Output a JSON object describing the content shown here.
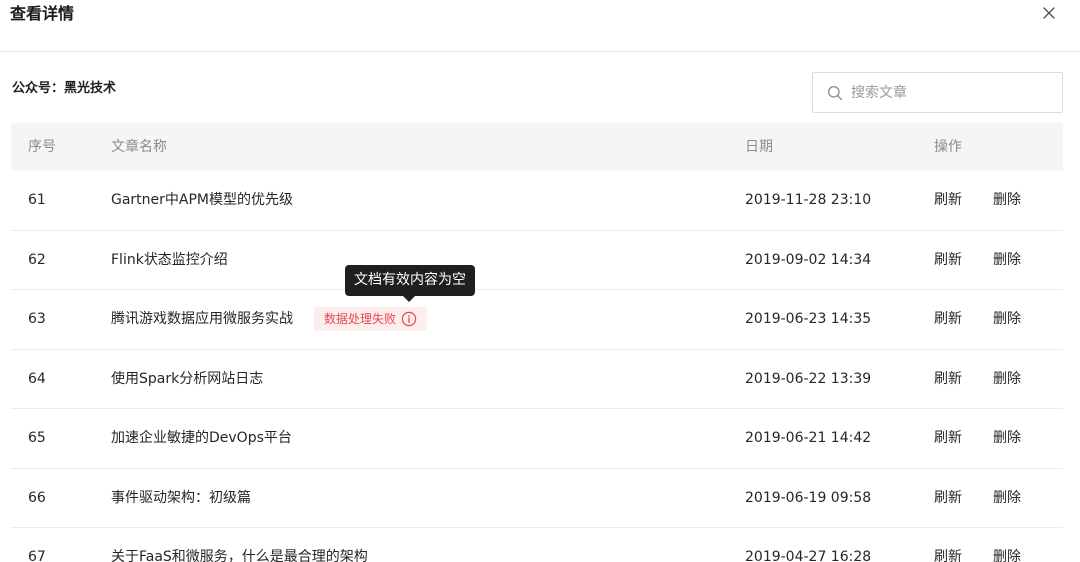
{
  "dialog": {
    "title": "查看详情"
  },
  "account": {
    "label": "公众号：黑光技术"
  },
  "search": {
    "placeholder": "搜索文章"
  },
  "table": {
    "headers": {
      "num": "序号",
      "name": "文章名称",
      "date": "日期",
      "ops": "操作"
    },
    "rows": [
      {
        "num": "61",
        "name": "Gartner中APM模型的优先级",
        "date": "2019-11-28 23:10",
        "refresh": "刷新",
        "delete": "删除"
      },
      {
        "num": "62",
        "name": "Flink状态监控介绍",
        "date": "2019-09-02 14:34",
        "refresh": "刷新",
        "delete": "删除"
      },
      {
        "num": "63",
        "name": "腾讯游戏数据应用微服务实战",
        "date": "2019-06-23 14:35",
        "refresh": "刷新",
        "delete": "删除",
        "status": "数据处理失败"
      },
      {
        "num": "64",
        "name": "使用Spark分析网站日志",
        "date": "2019-06-22 13:39",
        "refresh": "刷新",
        "delete": "删除"
      },
      {
        "num": "65",
        "name": "加速企业敏捷的DevOps平台",
        "date": "2019-06-21 14:42",
        "refresh": "刷新",
        "delete": "删除"
      },
      {
        "num": "66",
        "name": "事件驱动架构：初级篇",
        "date": "2019-06-19 09:58",
        "refresh": "刷新",
        "delete": "删除"
      },
      {
        "num": "67",
        "name": "关于FaaS和微服务，什么是最合理的架构",
        "date": "2019-04-27 16:28",
        "refresh": "刷新",
        "delete": "删除"
      }
    ]
  },
  "tooltip": {
    "text": "文档有效内容为空"
  },
  "colors": {
    "status_text": "#e5484d",
    "status_bg": "#fdeeee",
    "tooltip_bg": "#1f1f1f",
    "header_bg": "#f5f5f5"
  },
  "icons": {
    "close": "close-icon",
    "search": "search-icon",
    "info": "info-icon"
  }
}
